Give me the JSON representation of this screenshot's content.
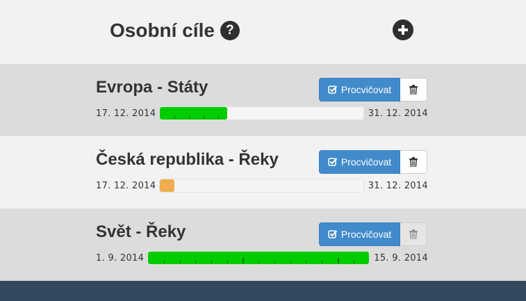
{
  "header": {
    "title": "Osobní cíle",
    "help_icon": "question-circle-icon",
    "add_icon": "plus-circle-icon"
  },
  "goals": [
    {
      "title": "Evropa - Státy",
      "practice_label": "Procvičovat",
      "start_date": "17. 12. 2014",
      "end_date": "31. 12. 2014",
      "progress": 0.33,
      "color": "#00cc00",
      "delete_disabled": false
    },
    {
      "title": "Česká republika - Řeky",
      "practice_label": "Procvičovat",
      "start_date": "17. 12. 2014",
      "end_date": "31. 12. 2014",
      "progress": 0.07,
      "color": "#f0ad4e",
      "delete_disabled": false
    },
    {
      "title": "Svět - Řeky",
      "practice_label": "Procvičovat",
      "start_date": "1. 9. 2014",
      "end_date": "15. 9. 2014",
      "progress": 1.0,
      "color": "#00cc00",
      "delete_disabled": true
    }
  ],
  "colors": {
    "primary": "#428bca",
    "footer": "#34495e",
    "success": "#00cc00",
    "warning": "#f0ad4e"
  }
}
